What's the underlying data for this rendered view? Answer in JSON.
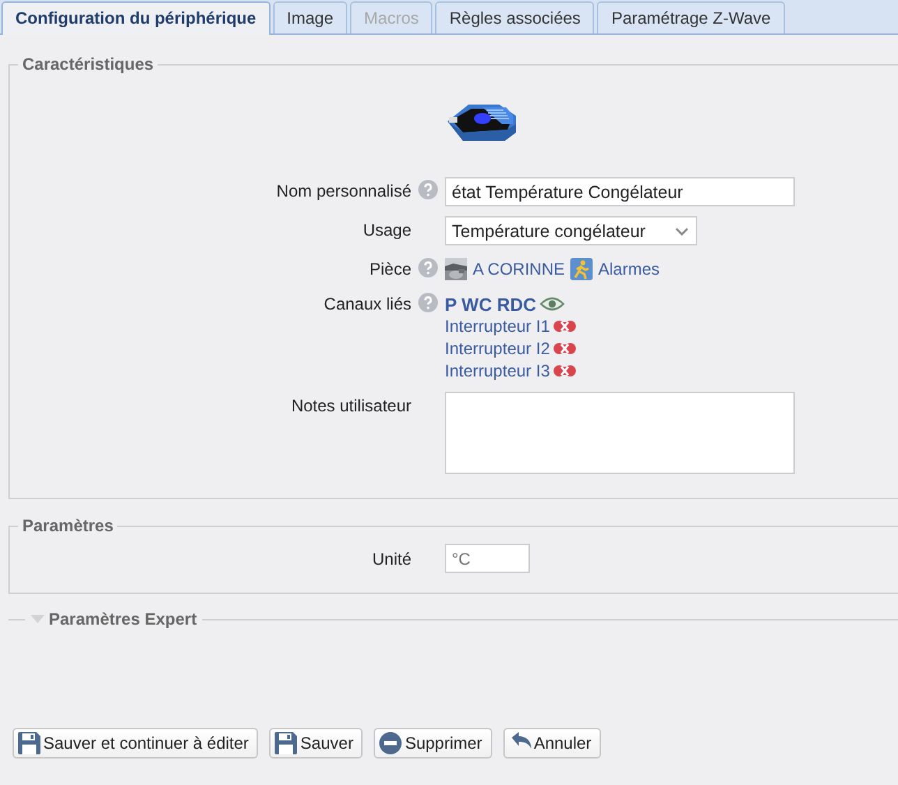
{
  "tabs": [
    {
      "label": "Configuration du périphérique",
      "selected": true,
      "disabled": false
    },
    {
      "label": "Image",
      "selected": false,
      "disabled": false
    },
    {
      "label": "Macros",
      "selected": false,
      "disabled": true
    },
    {
      "label": "Règles associées",
      "selected": false,
      "disabled": false
    },
    {
      "label": "Paramétrage Z-Wave",
      "selected": false,
      "disabled": false
    }
  ],
  "characteristics": {
    "legend": "Caractéristiques",
    "rows": [
      {
        "kind": "text",
        "label": "Nom personnalisé",
        "help": true,
        "value": "état Température Congélateur"
      },
      {
        "kind": "select",
        "label": "Usage",
        "help": false,
        "value": "Température congélateur"
      },
      {
        "kind": "links",
        "label": "Pièce",
        "help": true,
        "items": [
          {
            "text": "A CORINNE"
          },
          {
            "kind": "alarm",
            "text": "Alarmes"
          }
        ]
      },
      {
        "kind": "channels",
        "label": "Canaux liés",
        "help": true,
        "items": [
          {
            "kind": "main",
            "text": "P WC RDC"
          },
          {
            "kind": "linked",
            "text": "Interrupteur I1"
          },
          {
            "kind": "linked",
            "text": "Interrupteur I2"
          },
          {
            "kind": "linked",
            "text": "Interrupteur I3"
          }
        ]
      },
      {
        "kind": "textarea",
        "label": "Notes utilisateur",
        "help": false
      }
    ]
  },
  "parameters": {
    "legend": "Paramètres",
    "unit": {
      "label": "Unité",
      "placeholder": "°C"
    }
  },
  "expert": {
    "legend": "Paramètres Expert",
    "expanded": false
  },
  "buttons": [
    {
      "kind": "save-continue",
      "label": "Sauver et continuer à éditer"
    },
    {
      "kind": "save",
      "label": "Sauver"
    },
    {
      "kind": "delete",
      "label": "Supprimer"
    },
    {
      "kind": "cancel",
      "label": "Annuler"
    }
  ]
}
